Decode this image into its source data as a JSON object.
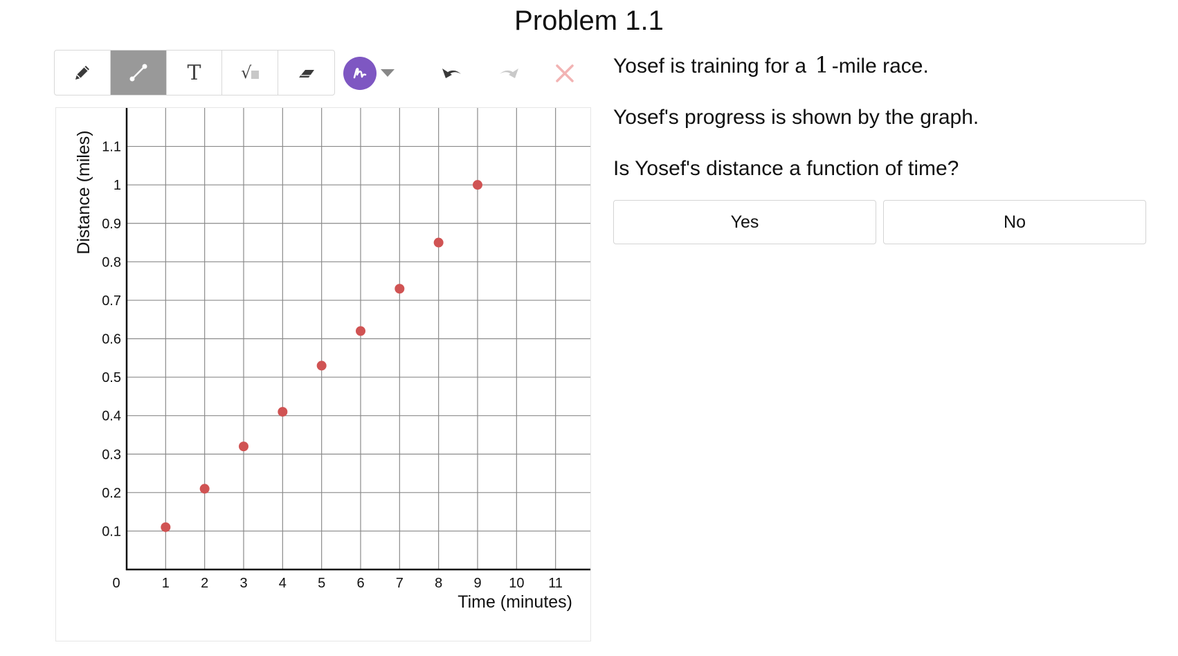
{
  "page": {
    "title": "Problem 1.1"
  },
  "toolbar": {
    "tools": [
      {
        "icon": "pencil-icon",
        "active": false
      },
      {
        "icon": "line-segment-icon",
        "active": true
      },
      {
        "icon": "text-tool-icon",
        "label": "T",
        "active": false
      },
      {
        "icon": "math-root-icon",
        "label": "√",
        "active": false
      },
      {
        "icon": "eraser-icon",
        "active": false
      }
    ],
    "pen_color": "#7e57c2",
    "actions": [
      {
        "icon": "undo-icon",
        "enabled": true
      },
      {
        "icon": "redo-icon",
        "enabled": false
      },
      {
        "icon": "clear-icon",
        "enabled": false
      }
    ]
  },
  "question": {
    "line1_before": "Yosef is training for a",
    "line1_math": "1",
    "line1_after": "-mile race.",
    "line2": "Yosef's progress is shown by the graph.",
    "line3": "Is Yosef's distance a function of time?",
    "choices": [
      "Yes",
      "No"
    ]
  },
  "chart_data": {
    "type": "scatter",
    "xlabel": "Time (minutes)",
    "ylabel": "Distance (miles)",
    "xlim": [
      0,
      12
    ],
    "ylim": [
      0,
      1.2
    ],
    "xticks": [
      0,
      1,
      2,
      3,
      4,
      5,
      6,
      7,
      8,
      9,
      10,
      11
    ],
    "xtick_labels": [
      "0",
      "1",
      "2",
      "3",
      "4",
      "5",
      "6",
      "7",
      "8",
      "9",
      "10",
      "11"
    ],
    "yticks": [
      0.1,
      0.2,
      0.3,
      0.4,
      0.5,
      0.6,
      0.7,
      0.8,
      0.9,
      1,
      1.1
    ],
    "ytick_labels": [
      "0.1",
      "0.2",
      "0.3",
      "0.4",
      "0.5",
      "0.6",
      "0.7",
      "0.8",
      "0.9",
      "1",
      "1.1"
    ],
    "grid": true,
    "point_color": "#d05353",
    "points": [
      {
        "x": 1,
        "y": 0.11
      },
      {
        "x": 2,
        "y": 0.21
      },
      {
        "x": 3,
        "y": 0.32
      },
      {
        "x": 4,
        "y": 0.41
      },
      {
        "x": 5,
        "y": 0.53
      },
      {
        "x": 6,
        "y": 0.62
      },
      {
        "x": 7,
        "y": 0.73
      },
      {
        "x": 8,
        "y": 0.85
      },
      {
        "x": 9,
        "y": 1
      }
    ]
  }
}
